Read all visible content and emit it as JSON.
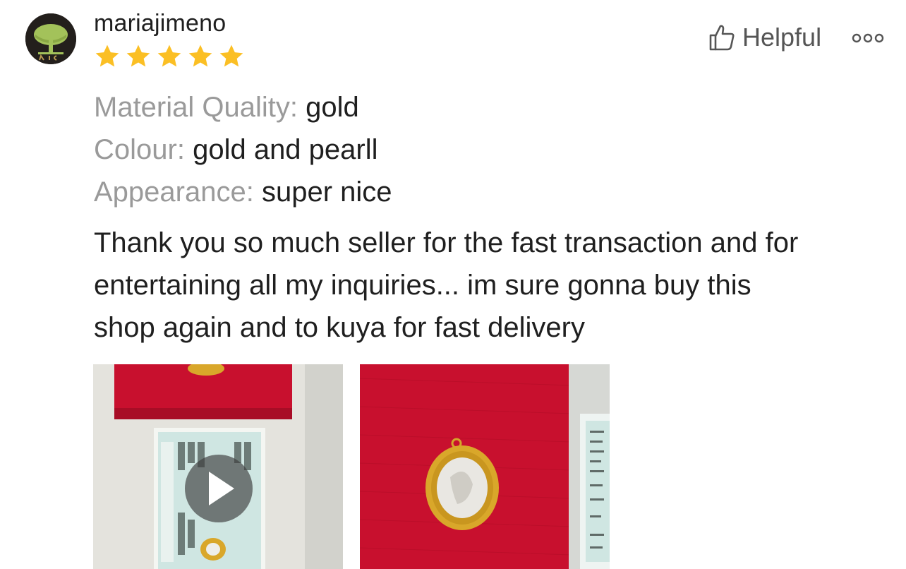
{
  "review": {
    "username": "mariajimeno",
    "rating": 5,
    "rating_max": 5,
    "helpful_label": "Helpful",
    "attributes": [
      {
        "label": "Material Quality:",
        "value": "gold"
      },
      {
        "label": "Colour:",
        "value": "gold and pearll"
      },
      {
        "label": "Appearance:",
        "value": "super nice"
      }
    ],
    "text_lines": [
      "Thank you so much seller for the fast transaction and for",
      "entertaining all my inquiries... im sure gonna buy this",
      "shop again and to kuya for fast delivery"
    ],
    "media": [
      {
        "type": "video",
        "icon": "play-icon"
      },
      {
        "type": "photo"
      }
    ]
  },
  "colors": {
    "star": "#fbbf24",
    "muted_label": "#9a9a9a",
    "text": "#1f1f1f",
    "red_box": "#c8102e"
  },
  "icons": {
    "helpful": "thumbs-up-icon",
    "more": "more-options-icon",
    "avatar": "avatar-tree-logo"
  }
}
